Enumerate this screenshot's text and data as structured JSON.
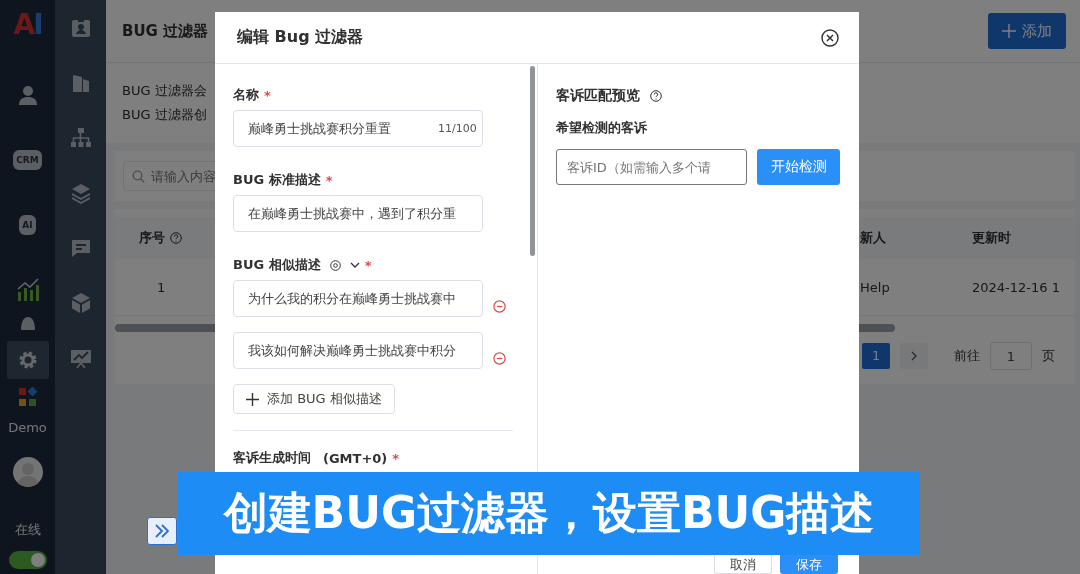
{
  "rail": {
    "logo": "AI",
    "items": [
      {
        "kind": "person",
        "selected": false
      },
      {
        "kind": "badge",
        "label": "CRM",
        "selected": false
      },
      {
        "kind": "badge",
        "label": "AI",
        "selected": false
      },
      {
        "kind": "chart",
        "selected": false
      },
      {
        "kind": "bell",
        "selected": false
      },
      {
        "kind": "gear",
        "selected": true
      },
      {
        "kind": "apps",
        "selected": false
      }
    ],
    "workspace": "Demo",
    "status": "在线",
    "online": true
  },
  "subnav": {
    "items": [
      {
        "kind": "idcard"
      },
      {
        "kind": "building"
      },
      {
        "kind": "tree"
      },
      {
        "kind": "layers"
      },
      {
        "kind": "chat"
      },
      {
        "kind": "cube"
      },
      {
        "kind": "presentation"
      }
    ]
  },
  "page": {
    "title": "BUG 过滤器",
    "add_button": "添加",
    "notes": [
      "BUG 过滤器会",
      "BUG 过滤器创"
    ],
    "search_placeholder": "请输入内容",
    "table": {
      "columns": [
        "序号",
        "新人",
        "更新时"
      ],
      "rows": [
        [
          "1",
          "Help",
          "2024-12-16 1"
        ]
      ]
    },
    "pagination": {
      "pages": [
        {
          "label": "1",
          "selected": true
        }
      ],
      "goto_label": "前往",
      "goto_value": "1",
      "page_suffix": "页"
    }
  },
  "dialog": {
    "title": "编辑 Bug 过滤器",
    "required_mark": "*",
    "name": {
      "label": "名称",
      "value": "巅峰勇士挑战赛积分重置",
      "count": "11/100"
    },
    "standard": {
      "label": "BUG 标准描述",
      "value": "在巅峰勇士挑战赛中，遇到了积分重"
    },
    "similar": {
      "label": "BUG 相似描述",
      "items": [
        "为什么我的积分在巅峰勇士挑战赛中",
        "我该如何解决巅峰勇士挑战赛中积分"
      ],
      "add_button": "添加 BUG 相似描述"
    },
    "time_label": "客诉生成时间",
    "time_zone": "(GMT+0)",
    "preview": {
      "title": "客诉匹配预览",
      "subtitle": "希望检测的客诉",
      "placeholder": "客诉ID（如需输入多个请",
      "button": "开始检测"
    },
    "cancel": "取消",
    "save": "保存"
  },
  "caption": "创建BUG过滤器，设置BUG描述"
}
